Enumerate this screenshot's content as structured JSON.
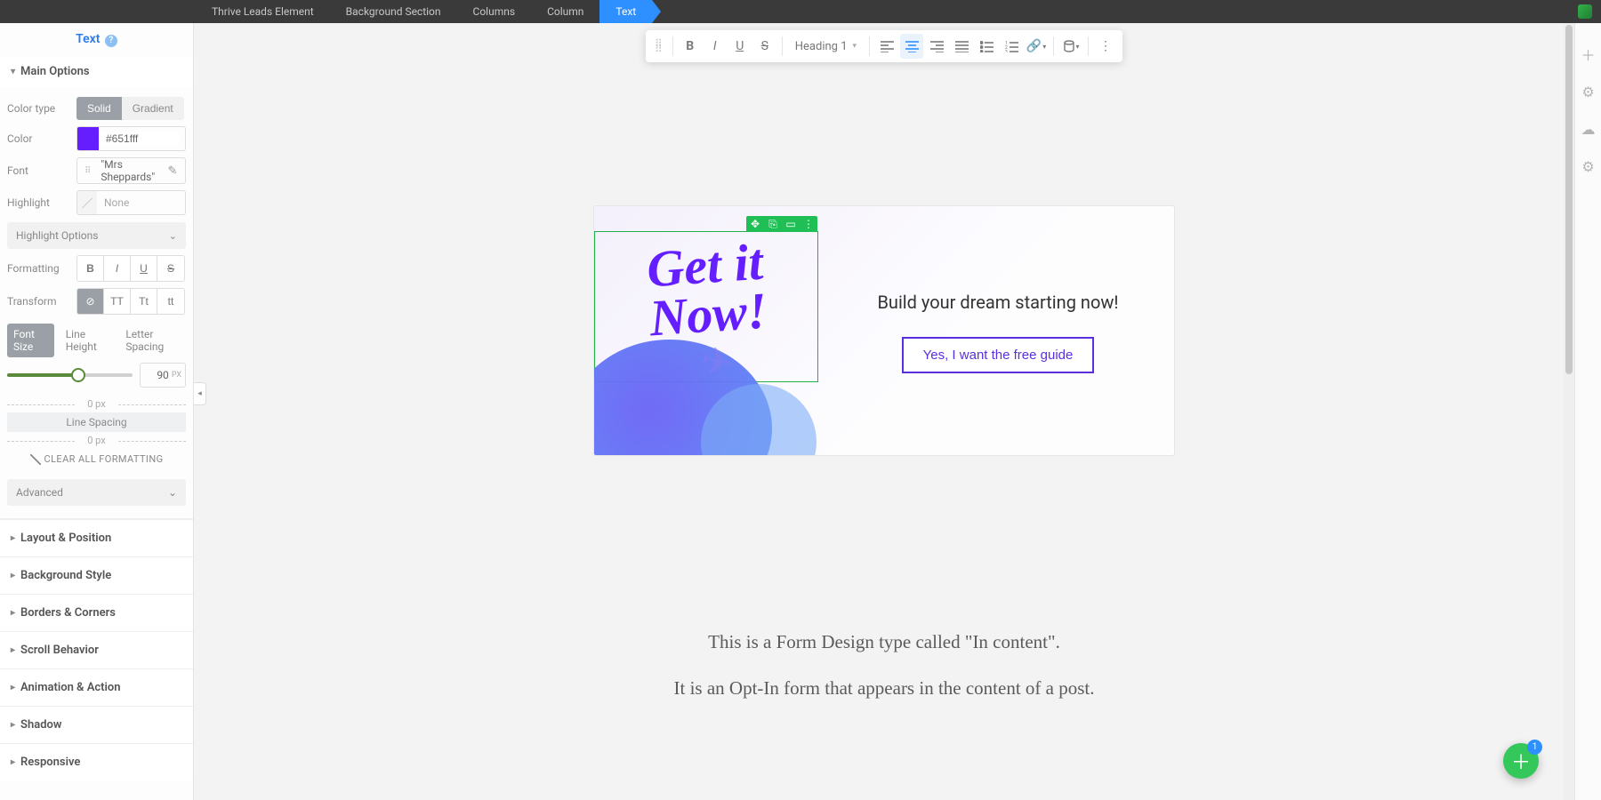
{
  "breadcrumbs": [
    "Thrive Leads Element",
    "Background Section",
    "Columns",
    "Column",
    "Text"
  ],
  "active_breadcrumb": 4,
  "sidebar": {
    "title": "Text",
    "main_options": {
      "title": "Main Options",
      "color_type_label": "Color type",
      "color_type": {
        "solid": "Solid",
        "gradient": "Gradient",
        "active": "solid"
      },
      "color_label": "Color",
      "color_value": "#651fff",
      "font_label": "Font",
      "font_value": "\"Mrs Sheppards\"",
      "highlight_label": "Highlight",
      "highlight_value": "None",
      "highlight_options": "Highlight Options",
      "formatting_label": "Formatting",
      "formatting": {
        "b": "B",
        "i": "I",
        "u": "U",
        "s": "S"
      },
      "transform_label": "Transform",
      "transform": {
        "none": "⊘",
        "upper": "TT",
        "cap": "Tt",
        "lower": "tt"
      },
      "size_tabs": {
        "font_size": "Font Size",
        "line_height": "Line Height",
        "letter_spacing": "Letter Spacing"
      },
      "size_value": "90",
      "size_unit": "PX",
      "px_top": "0 px",
      "line_spacing_label": "Line Spacing",
      "px_bottom": "0 px",
      "clear_formatting": "CLEAR ALL FORMATTING",
      "advanced": "Advanced"
    },
    "panels": [
      "Layout & Position",
      "Background Style",
      "Borders & Corners",
      "Scroll Behavior",
      "Animation & Action",
      "Shadow",
      "Responsive"
    ]
  },
  "toolbar": {
    "heading": "Heading 1"
  },
  "card": {
    "headline": "Get it\nNow!",
    "subhead": "Build your dream starting now!",
    "cta": "Yes, I want the free guide"
  },
  "page_text": {
    "l1": "This is a Form Design type called \"In content\".",
    "l2": "It is an Opt-In form that appears in the content of a post."
  },
  "fab_badge": "1"
}
